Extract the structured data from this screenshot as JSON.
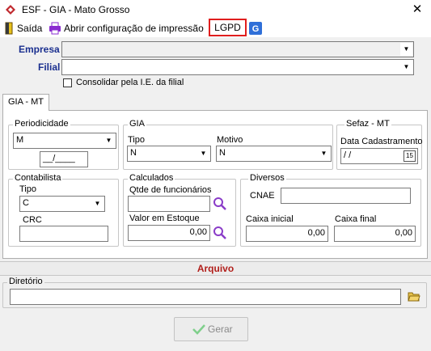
{
  "window": {
    "title": "ESF - GIA - Mato Grosso",
    "close_glyph": "✕"
  },
  "toolbar": {
    "exit_label": "Saída",
    "print_config_label": "Abrir configuração de impressão",
    "lgpd_label": "LGPD"
  },
  "header": {
    "empresa_label": "Empresa",
    "filial_label": "Filial",
    "consolidar_label": "Consolidar pela I.E. da filial"
  },
  "tabs": [
    {
      "label": "GIA - MT"
    }
  ],
  "periodicidade": {
    "title": "Periodicidade",
    "selected": "M",
    "date_value": "__/____"
  },
  "gia": {
    "title": "GIA",
    "tipo_label": "Tipo",
    "tipo_value": "N",
    "motivo_label": "Motivo",
    "motivo_value": "N"
  },
  "sefaz": {
    "title": "Sefaz - MT",
    "data_label": "Data Cadastramento",
    "data_value": " /  /",
    "calendar_day": "15"
  },
  "contabilista": {
    "title": "Contabilista",
    "tipo_label": "Tipo",
    "tipo_value": "C",
    "crc_label": "CRC",
    "crc_value": ""
  },
  "calculados": {
    "title": "Calculados",
    "funcionarios_label": "Qtde de funcionários",
    "funcionarios_value": "",
    "estoque_label": "Valor em Estoque",
    "estoque_value": "0,00"
  },
  "diversos": {
    "title": "Diversos",
    "cnae_label": "CNAE",
    "cnae_value": "",
    "caixa_inicial_label": "Caixa inicial",
    "caixa_inicial_value": "0,00",
    "caixa_final_label": "Caixa final",
    "caixa_final_value": "0,00"
  },
  "arquivo": {
    "section_label": "Arquivo",
    "diretorio_label": "Diretório",
    "diretorio_value": ""
  },
  "actions": {
    "gerar_label": "Gerar"
  },
  "colors": {
    "label_blue": "#1a2f8f",
    "lgpd_border": "#e01e1e",
    "arquivo_red": "#b2201c",
    "search_purple": "#8a3cc8"
  }
}
